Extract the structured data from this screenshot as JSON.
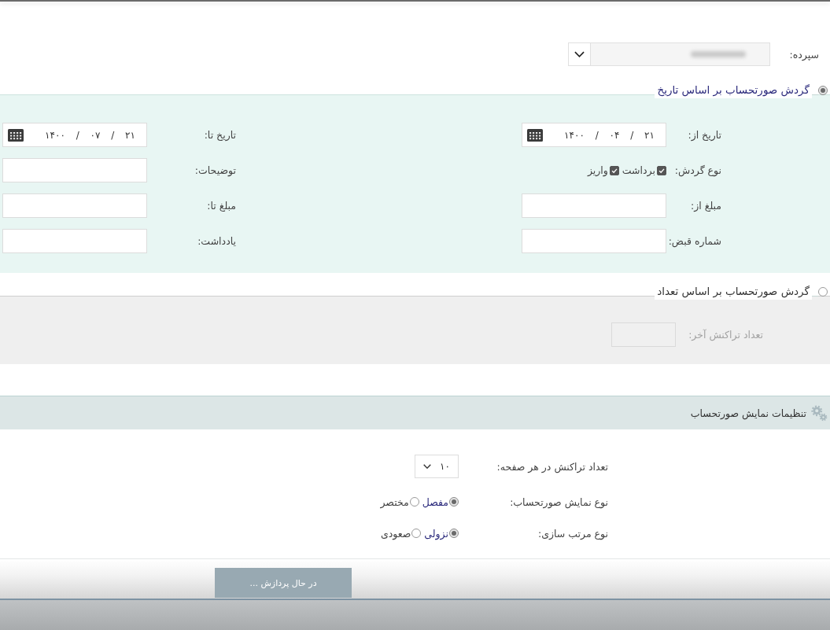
{
  "account": {
    "label": "سپرده:"
  },
  "filter_modes": [
    {
      "kind": "date",
      "label": "گردش صورتحساب بر اساس تاریخ",
      "selected": true,
      "fields": [
        {
          "kind": "date",
          "label": "تاریخ از:",
          "value": "۲۱ / ۰۴ / ۱۴۰۰"
        },
        {
          "kind": "date",
          "label": "تاریخ تا:",
          "value": "۲۱ / ۰۷ / ۱۴۰۰"
        },
        {
          "kind": "checks",
          "label": "نوع گردش:",
          "options": [
            {
              "label": "برداشت",
              "checked": true
            },
            {
              "label": "واریز",
              "checked": true
            }
          ]
        },
        {
          "kind": "text",
          "label": "توضیحات:"
        },
        {
          "kind": "text",
          "label": "مبلغ از:"
        },
        {
          "kind": "text",
          "label": "مبلغ تا:"
        },
        {
          "kind": "text",
          "label": "شماره قبض:"
        },
        {
          "kind": "text",
          "label": "یادداشت:"
        }
      ]
    },
    {
      "kind": "count",
      "label": "گردش صورتحساب بر اساس تعداد",
      "selected": false,
      "fields": [
        {
          "kind": "text",
          "label": "تعداد تراکنش آخر:"
        }
      ]
    }
  ],
  "display_settings": {
    "title": "تنظیمات نمایش صورتحساب",
    "rows": [
      {
        "kind": "select",
        "label": "تعداد تراکنش در هر صفحه:",
        "value": "۱۰"
      },
      {
        "kind": "radio",
        "label": "نوع نمایش صورتحساب:",
        "options": [
          {
            "label": "مفصل",
            "selected": true
          },
          {
            "label": "مختصر",
            "selected": false
          }
        ]
      },
      {
        "kind": "radio",
        "label": "نوع مرتب سازی:",
        "options": [
          {
            "label": "نزولی",
            "selected": true
          },
          {
            "label": "صعودی",
            "selected": false
          }
        ]
      }
    ]
  },
  "submit_button": {
    "label": "در حال پردازش ...",
    "disabled": true
  }
}
